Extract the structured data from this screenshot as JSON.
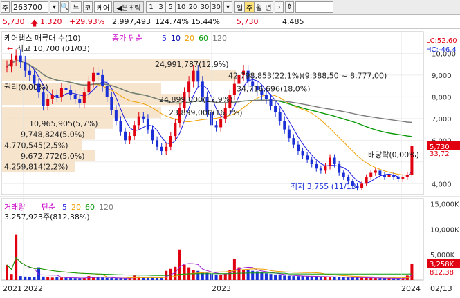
{
  "toolbar": {
    "mode_label": "주",
    "stock_code": "263700",
    "new_label": "뉴",
    "name_button_label": "코",
    "stock_name": "케어",
    "interval_label": "◀분초틱",
    "intervals": [
      "1",
      "3",
      "5",
      "10",
      "20",
      "30",
      "30"
    ],
    "period_tabs": [
      "일",
      "주",
      "월",
      "년"
    ],
    "active_period": "주"
  },
  "quote": {
    "price": "5,730",
    "change": "1,320",
    "change_pct": "+29.93%",
    "volume": "2,997,493",
    "vol_ratio": "124.74%",
    "turnover": "15.44%",
    "price2": "5,730",
    "low": "4,485"
  },
  "legend": {
    "main": "케어랩스 매류대 수(10)",
    "ma_label": "종가 단순",
    "ma_periods": [
      "5",
      "10",
      "20",
      "60",
      "120"
    ],
    "ma_colors": [
      "#1a1adf",
      "#0000aa",
      "#f0a000",
      "#0a9a0a",
      "#7a7a7a"
    ]
  },
  "price_panel": {
    "lc": "LC:52.60",
    "hc": "HC:-46.4",
    "y_ticks": [
      "10,000",
      "9,000",
      "8,000",
      "7,000",
      "6,000",
      "4,000"
    ],
    "current_price_tag": "5,730",
    "prev_tag": "33,72",
    "high_note": "최고 10,700 (01/03)",
    "low_note": "최저 3,755 (11/13)",
    "dividend_note": "배당락(0,00%)",
    "left_note": "권리(0,00%)",
    "volume_profile": [
      {
        "label": "24,991,787(12,9%)",
        "y": 9.5
      },
      {
        "label": "42,798,853(22,1%)(9,388,50 ~ 8,777,00)",
        "y": 8.98
      },
      {
        "label": "34,716,696(18,0%)",
        "y": 8.38
      },
      {
        "label": "24,899,000(12,9%)",
        "y": 7.88
      },
      {
        "label": "23,899,000(16,7%)",
        "y": 7.28
      },
      {
        "label": "10,965,905(5,7%)",
        "y": 6.78
      },
      {
        "label": "9,748,824(5,0%)",
        "y": 6.28
      },
      {
        "label": "4,770,545(2,5%)",
        "y": 5.78
      },
      {
        "label": "9,672,772(5,0%)",
        "y": 5.28
      },
      {
        "label": "4,259,814(2,2%)",
        "y": 4.78
      }
    ]
  },
  "volume_panel": {
    "title": "거래량",
    "ma_label": "단순",
    "ma_periods": [
      "5",
      "20",
      "60",
      "120"
    ],
    "peak_label": "3,257,923주(812,38%)",
    "y_ticks": [
      "15,000K",
      "10,000K",
      "5,000K"
    ],
    "current_tag": "3,258K",
    "pct_tag": "812,38"
  },
  "x_axis": [
    "2021",
    "2022",
    "2023",
    "2024",
    "02/13"
  ],
  "chart_data": {
    "type": "candlestick",
    "title": "케어랩스",
    "period": "weekly",
    "ylim": [
      3500,
      11000
    ],
    "price_close": [
      9400,
      9700,
      9900,
      9600,
      9200,
      9000,
      8600,
      8200,
      7600,
      7900,
      8100,
      8000,
      8400,
      8300,
      8100,
      7900,
      7700,
      8200,
      8700,
      9100,
      9000,
      8500,
      8000,
      7400,
      6900,
      6400,
      6000,
      6200,
      6700,
      7100,
      7000,
      6500,
      6000,
      5700,
      5500,
      5700,
      6200,
      6800,
      7500,
      8200,
      8700,
      9200,
      8700,
      8000,
      7300,
      6700,
      6600,
      7000,
      7500,
      8100,
      8600,
      9000,
      9200,
      8700,
      8500,
      8300,
      8100,
      7900,
      7600,
      7300,
      6900,
      6500,
      6100,
      5800,
      5500,
      5300,
      5100,
      4900,
      4700,
      4600,
      4800,
      5200,
      4900,
      4500,
      4300,
      4100,
      3900,
      3800,
      4000,
      4300,
      4500,
      4600,
      4400,
      4300,
      4400,
      4300,
      4200,
      4300,
      4400,
      5730
    ],
    "volume_k": [
      3000,
      1200,
      9000,
      800,
      700,
      650,
      600,
      2500,
      700,
      600,
      500,
      550,
      500,
      450,
      400,
      380,
      360,
      420,
      800,
      600,
      500,
      480,
      450,
      400,
      380,
      350,
      330,
      340,
      900,
      700,
      600,
      500,
      450,
      420,
      400,
      1800,
      2200,
      2600,
      6000,
      3000,
      2500,
      2000,
      1800,
      1500,
      1400,
      1200,
      1100,
      1000,
      1300,
      2000,
      4200,
      2500,
      2000,
      1900,
      1800,
      1700,
      1500,
      1300,
      1200,
      1100,
      1000,
      900,
      850,
      800,
      780,
      760,
      740,
      720,
      700,
      680,
      650,
      600,
      580,
      560,
      540,
      520,
      500,
      480,
      460,
      440,
      420,
      400,
      380,
      360,
      340,
      320,
      300,
      280,
      900,
      3258
    ],
    "ma5_note": "5-period moving average",
    "ma20_note": "20-period moving average",
    "ma60_note": "60-period moving average",
    "ma120_note": "120-period moving average"
  }
}
